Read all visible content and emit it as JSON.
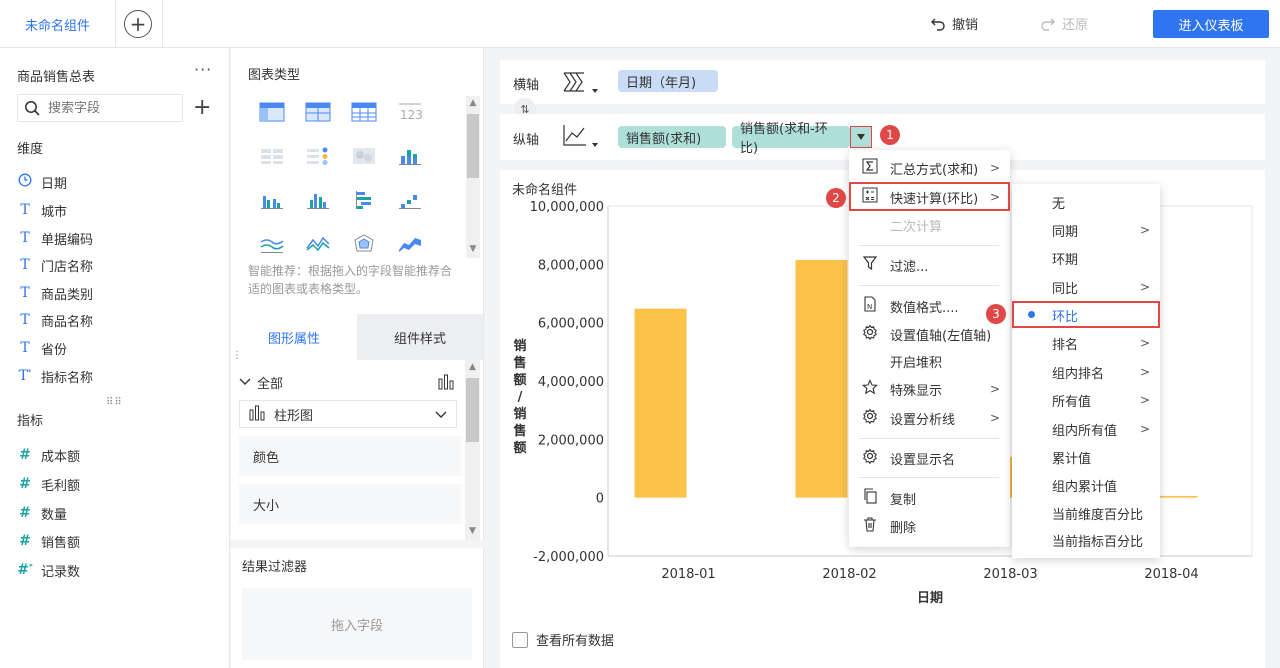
{
  "topbar": {
    "active_tab": "未命名组件",
    "undo_label": "撤销",
    "redo_label": "还原",
    "enter_dashboard": "进入仪表板"
  },
  "dataset": {
    "title": "商品销售总表",
    "more": "···",
    "search_placeholder": "搜索字段",
    "dimensions_label": "维度",
    "dimensions": [
      "日期",
      "城市",
      "单据编码",
      "门店名称",
      "商品类别",
      "商品名称",
      "省份",
      "指标名称"
    ],
    "measures_label": "指标",
    "measures": [
      "成本额",
      "毛利额",
      "数量",
      "销售额",
      "记录数"
    ]
  },
  "chart_types": {
    "title": "图表类型",
    "hint": "智能推荐：根据拖入的字段智能推荐合适的图表或表格类型。"
  },
  "properties": {
    "tab_active": "图形属性",
    "tab_other": "组件样式",
    "all_label": "全部",
    "chart_kind": "柱形图",
    "items": [
      "颜色",
      "大小"
    ]
  },
  "result_filter": {
    "title": "结果过滤器",
    "drop_hint": "拖入字段"
  },
  "axes": {
    "x_label": "横轴",
    "y_label": "纵轴",
    "x_pill": "日期（年月)",
    "y_pill_1": "销售额(求和)",
    "y_pill_2": "销售额(求和-环比)"
  },
  "chart": {
    "component_title": "未命名组件",
    "show_all_data": "查看所有数据"
  },
  "chart_data": {
    "type": "bar",
    "categories": [
      "2018-01",
      "2018-02",
      "2018-03",
      "2018-04"
    ],
    "values": [
      6480000,
      8150000,
      1400000,
      60000
    ],
    "xlabel": "日期",
    "ylabel": "销售额/销售额",
    "ylim": [
      -2000000,
      10000000
    ],
    "yticks": [
      "10,000,000",
      "8,000,000",
      "6,000,000",
      "4,000,000",
      "2,000,000",
      "0",
      "-2,000,000"
    ],
    "ytick_values": [
      10000000,
      8000000,
      6000000,
      4000000,
      2000000,
      0,
      -2000000
    ],
    "bar_color": "#fcc24a"
  },
  "menu1": {
    "items": [
      {
        "label": "汇总方式(求和)",
        "arrow": ">"
      },
      {
        "label": "快速计算(环比)",
        "arrow": ">"
      },
      {
        "label": "二次计算"
      },
      {
        "label": "过滤..."
      },
      {
        "label": "数值格式...."
      },
      {
        "label": "设置值轴(左值轴)"
      },
      {
        "label": "开启堆积"
      },
      {
        "label": "特殊显示",
        "arrow": ">"
      },
      {
        "label": "设置分析线",
        "arrow": ">"
      },
      {
        "label": "设置显示名"
      },
      {
        "label": "复制"
      },
      {
        "label": "删除"
      }
    ]
  },
  "menu2": {
    "items": [
      {
        "label": "无"
      },
      {
        "label": "同期",
        "arrow": ">"
      },
      {
        "label": "环期"
      },
      {
        "label": "同比",
        "arrow": ">"
      },
      {
        "label": "环比"
      },
      {
        "label": "排名",
        "arrow": ">"
      },
      {
        "label": "组内排名",
        "arrow": ">"
      },
      {
        "label": "所有值",
        "arrow": ">"
      },
      {
        "label": "组内所有值",
        "arrow": ">"
      },
      {
        "label": "累计值"
      },
      {
        "label": "组内累计值"
      },
      {
        "label": "当前维度百分比"
      },
      {
        "label": "当前指标百分比"
      }
    ]
  },
  "badges": [
    "1",
    "2",
    "3"
  ],
  "colors": {
    "accent": "#2f74f0",
    "pill_measure": "#aedfd8",
    "pill_dimension": "#c9dcf6",
    "highlight": "#e04848"
  }
}
